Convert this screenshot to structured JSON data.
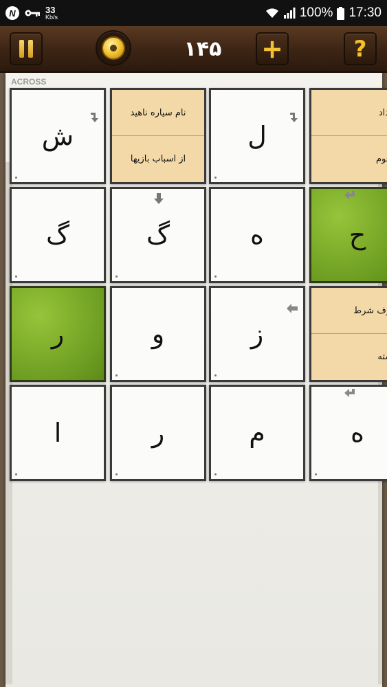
{
  "status_bar": {
    "speed_value": "33",
    "speed_unit": "Kb/s",
    "battery": "100%",
    "time": "17:30"
  },
  "toolbar": {
    "level_number": "۱۴۵"
  },
  "paper": {
    "label": "ACROSS"
  },
  "grid": {
    "rows": [
      [
        {
          "type": "letter",
          "value": "ش"
        },
        {
          "type": "clue",
          "top": "نام سیاره ناهید",
          "bottom": "از اسباب بازیها"
        },
        {
          "type": "letter",
          "value": "ل"
        },
        {
          "type": "clue",
          "top": "تعداد",
          "bottom": "هجوم"
        }
      ],
      [
        {
          "type": "letter",
          "value": "گ"
        },
        {
          "type": "letter",
          "value": "گ"
        },
        {
          "type": "letter",
          "value": "ه"
        },
        {
          "type": "letter",
          "value": "ح",
          "highlight": "green"
        }
      ],
      [
        {
          "type": "letter",
          "value": "ر",
          "highlight": "green"
        },
        {
          "type": "letter",
          "value": "و"
        },
        {
          "type": "letter",
          "value": "ز"
        },
        {
          "type": "clue",
          "top": "حرف شرط",
          "bottom": "دسته"
        }
      ],
      [
        {
          "type": "letter",
          "value": "ا"
        },
        {
          "type": "letter",
          "value": "ر"
        },
        {
          "type": "letter",
          "value": "م"
        },
        {
          "type": "letter",
          "value": "ه"
        }
      ]
    ]
  },
  "colors": {
    "clue_bg": "#f3d9a7",
    "highlight_green": "#7fae2c",
    "toolbar_brown": "#3b2414",
    "accent_gold": "#f3c230"
  }
}
